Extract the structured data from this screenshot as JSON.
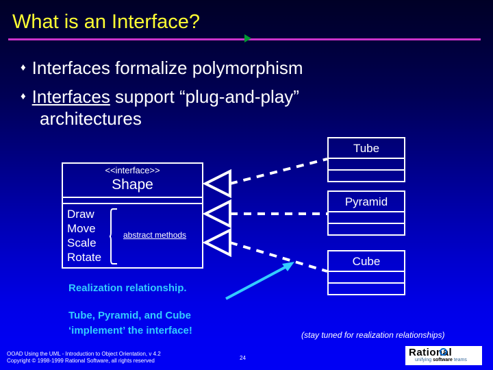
{
  "slide": {
    "title": "What is an Interface?",
    "bullet_glyph": "♦",
    "bullets": [
      {
        "text": "Interfaces formalize polymorphism"
      },
      {
        "lead": "Interfaces",
        "rest": " support “plug-and-play”",
        "cont": "architectures"
      }
    ]
  },
  "diagram": {
    "interface": {
      "stereotype": "<<interface>>",
      "name": "Shape",
      "operations": [
        "Draw",
        "Move",
        "Scale",
        "Rotate"
      ],
      "brace_label": "abstract methods"
    },
    "implementors": [
      {
        "name": "Tube"
      },
      {
        "name": "Pyramid"
      },
      {
        "name": "Cube"
      }
    ],
    "relationship_kind": "realization"
  },
  "annotations": {
    "note1": "Realization relationship.",
    "note2": "Tube, Pyramid, and Cube",
    "note3": "‘implement’ the interface!",
    "stay_tuned": "(stay tuned for realization relationships)"
  },
  "footer": {
    "line1": "OOAD Using the UML - Introduction to Object Orientation, v 4.2",
    "line2": "Copyright © 1998-1999 Rational Software, all rights reserved",
    "page_number": "24",
    "logo_word": "Rational",
    "logo_tagline_a": "unifying ",
    "logo_tagline_b": "software",
    "logo_tagline_c": " teams"
  },
  "colors": {
    "title": "#ffff33",
    "rule": "#cc33cc",
    "marker": "#009933",
    "body_text": "#ffffff",
    "annotation": "#33ccff",
    "box_stroke": "#ffffff",
    "background_top": "#000033",
    "background_bottom": "#0000f5"
  }
}
